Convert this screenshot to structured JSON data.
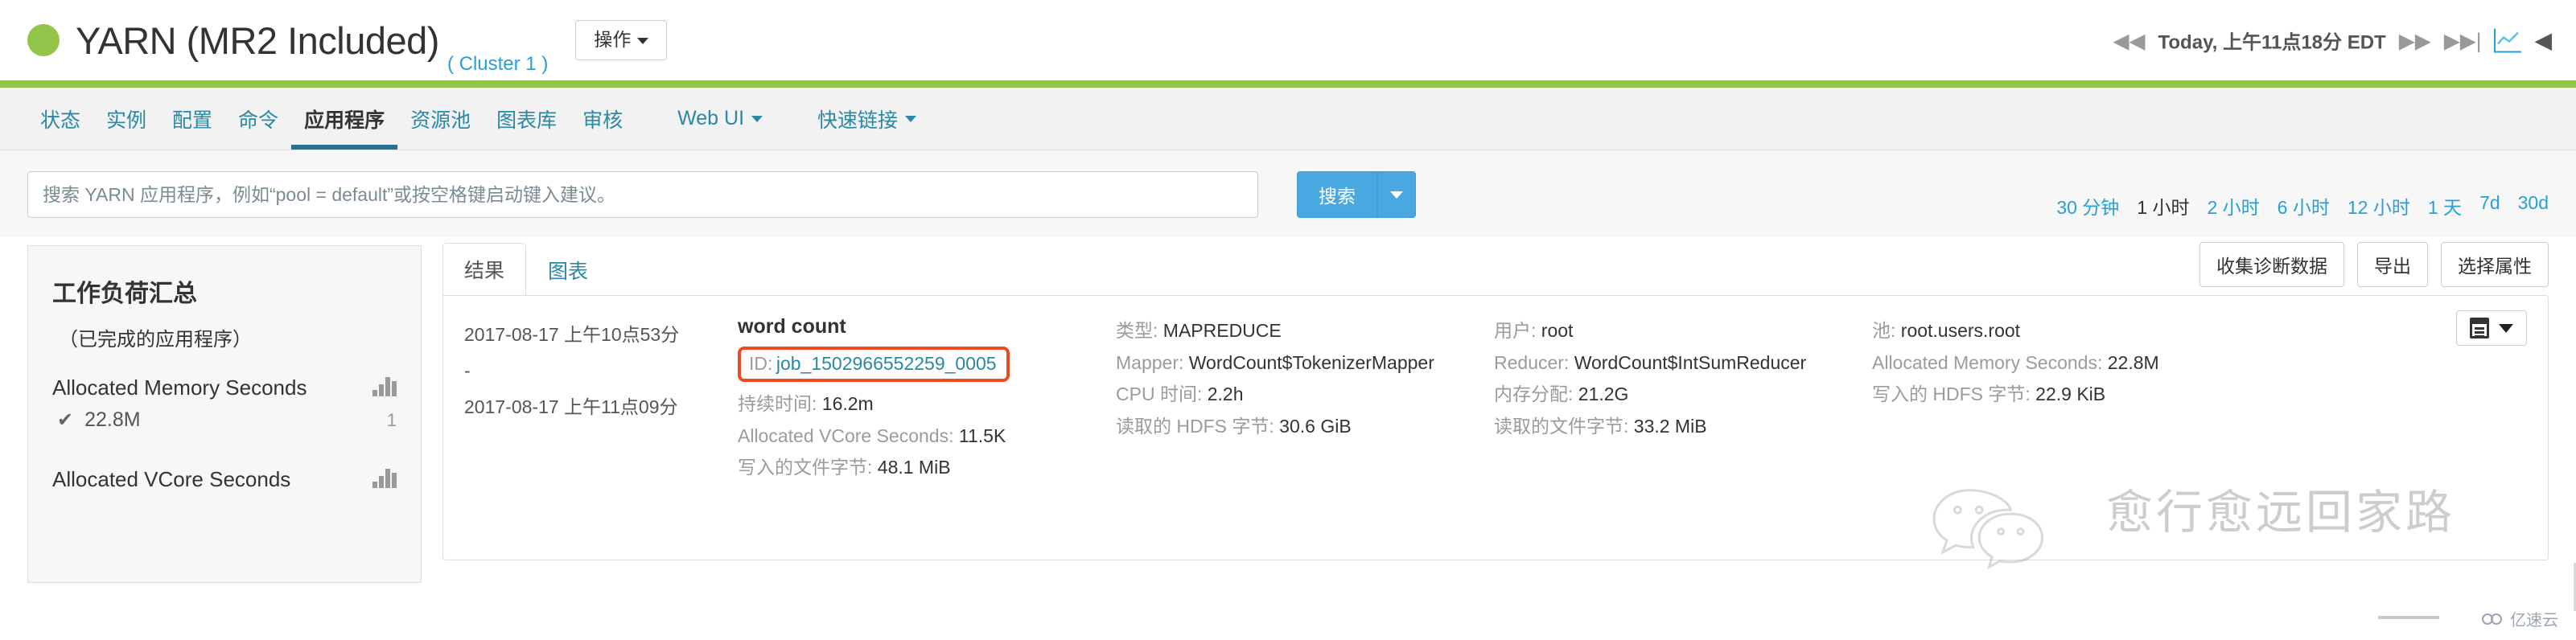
{
  "header": {
    "status_icon": "green-status-dot",
    "title": "YARN (MR2 Included)",
    "cluster_link": "( Cluster 1 )",
    "action_button": "操作",
    "time_label": "Today, 上午11点18分 EDT",
    "rewind_icon": "rewind-icon",
    "forward_icon": "fast-forward-icon",
    "skip_icon": "skip-to-end-icon",
    "chart_icon": "line-chart-icon",
    "collapse_icon": "collapse-left-icon"
  },
  "nav": {
    "items": [
      {
        "label": "状态",
        "active": false,
        "caret": false
      },
      {
        "label": "实例",
        "active": false,
        "caret": false
      },
      {
        "label": "配置",
        "active": false,
        "caret": false
      },
      {
        "label": "命令",
        "active": false,
        "caret": false
      },
      {
        "label": "应用程序",
        "active": true,
        "caret": false
      },
      {
        "label": "资源池",
        "active": false,
        "caret": false
      },
      {
        "label": "图表库",
        "active": false,
        "caret": false
      },
      {
        "label": "审核",
        "active": false,
        "caret": false
      },
      {
        "label": "Web UI",
        "active": false,
        "caret": true
      },
      {
        "label": "快速链接",
        "active": false,
        "caret": true
      }
    ]
  },
  "search": {
    "placeholder": "搜索 YARN 应用程序，例如“pool = default”或按空格键启动键入建议。",
    "value": "",
    "button_label": "搜索",
    "dropdown_icon": "chevron-down-icon",
    "time_ranges": [
      {
        "label": "30 分钟",
        "selected": false
      },
      {
        "label": "1 小时",
        "selected": true
      },
      {
        "label": "2 小时",
        "selected": false
      },
      {
        "label": "6 小时",
        "selected": false
      },
      {
        "label": "12 小时",
        "selected": false
      },
      {
        "label": "1 天",
        "selected": false
      },
      {
        "label": "7d",
        "selected": false
      },
      {
        "label": "30d",
        "selected": false
      }
    ]
  },
  "sidebar": {
    "title": "工作负荷汇总",
    "subtitle": "（已完成的应用程序）",
    "metrics": [
      {
        "name": "Allocated Memory Seconds",
        "value": "22.8M",
        "count": "1",
        "chart_icon": "bar-chart-icon",
        "check_icon": "check-icon"
      },
      {
        "name": "Allocated VCore Seconds",
        "value": "",
        "count": "",
        "chart_icon": "bar-chart-icon",
        "check_icon": ""
      }
    ]
  },
  "panel": {
    "tabs": [
      {
        "label": "结果",
        "active": true
      },
      {
        "label": "图表",
        "active": false
      }
    ],
    "buttons": [
      {
        "label": "收集诊断数据"
      },
      {
        "label": "导出"
      },
      {
        "label": "选择属性"
      }
    ]
  },
  "result": {
    "start_time": "2017-08-17 上午10点53分",
    "separator": "-",
    "end_time": "2017-08-17 上午11点09分",
    "app_name": "word count",
    "id_label": "ID:",
    "id_value": "job_1502966552259_0005",
    "id_highlight_color": "#f04a21",
    "fields_col1": [
      {
        "key": "持续时间:",
        "value": "16.2m"
      },
      {
        "key": "Allocated VCore Seconds:",
        "value": "11.5K"
      },
      {
        "key": "写入的文件字节:",
        "value": "48.1 MiB"
      }
    ],
    "fields_col2": [
      {
        "key": "类型:",
        "value": "MAPREDUCE"
      },
      {
        "key": "Mapper:",
        "value": "WordCount$TokenizerMapper"
      },
      {
        "key": "CPU 时间:",
        "value": "2.2h"
      },
      {
        "key": "读取的 HDFS 字节:",
        "value": "30.6 GiB"
      }
    ],
    "fields_col3": [
      {
        "key": "用户:",
        "value": "root"
      },
      {
        "key": "Reducer:",
        "value": "WordCount$IntSumReducer"
      },
      {
        "key": "内存分配:",
        "value": "21.2G"
      },
      {
        "key": "读取的文件字节:",
        "value": "33.2 MiB"
      }
    ],
    "fields_col4": [
      {
        "key": "池:",
        "value": "root.users.root"
      },
      {
        "key": "Allocated Memory Seconds:",
        "value": "22.8M"
      },
      {
        "key": "写入的 HDFS 字节:",
        "value": "22.9 KiB"
      }
    ],
    "row_menu_icon": "list-menu-icon"
  },
  "watermarks": {
    "main_text": "愈行愈远回家路",
    "wechat_icon": "wechat-icon",
    "corner_text": "亿速云",
    "corner_icon": "cloud-icon"
  }
}
